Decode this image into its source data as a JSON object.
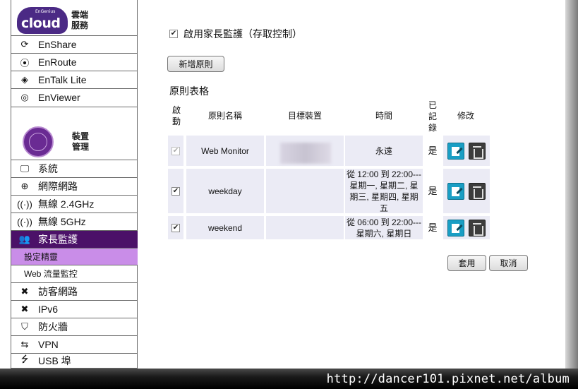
{
  "sidebar": {
    "logo": {
      "brand": "cloud",
      "maker": "EnGenius",
      "caption_line1": "雲端",
      "caption_line2": "服務"
    },
    "cloud_items": [
      {
        "label": "EnShare",
        "icon": "sync-icon"
      },
      {
        "label": "EnRoute",
        "icon": "location-pin-icon"
      },
      {
        "label": "EnTalk Lite",
        "icon": "compass-icon"
      },
      {
        "label": "EnViewer",
        "icon": "camera-lens-icon"
      }
    ],
    "device": {
      "caption_line1": "裝置",
      "caption_line2": "管理"
    },
    "device_items": [
      {
        "label": "系統",
        "icon": "monitor-icon"
      },
      {
        "label": "網際網路",
        "icon": "globe-icon"
      },
      {
        "label": "無線 2.4GHz",
        "icon": "wireless-icon"
      },
      {
        "label": "無線 5GHz",
        "icon": "wireless-icon"
      },
      {
        "label": "家長監護",
        "icon": "users-icon"
      }
    ],
    "sub_items": [
      {
        "label": "設定精靈"
      },
      {
        "label": "Web 流量監控"
      }
    ],
    "more_items": [
      {
        "label": "訪客網路",
        "icon": "tools-icon"
      },
      {
        "label": "IPv6",
        "icon": "tools-icon"
      },
      {
        "label": "防火牆",
        "icon": "shield-icon"
      },
      {
        "label": "VPN",
        "icon": "arrows-icon"
      },
      {
        "label": "USB 埠",
        "icon": "usb-icon"
      }
    ]
  },
  "main": {
    "enable_label": "啟用家長監護（存取控制）",
    "add_rule_button": "新增原則",
    "table_title": "原則表格",
    "headers": {
      "enabled_1": "啟",
      "enabled_2": "動",
      "name": "原則名稱",
      "target": "目標裝置",
      "time": "時間",
      "logged_1": "已",
      "logged_2": "記",
      "logged_3": "錄",
      "edit": "修改"
    },
    "rules": [
      {
        "name": "Web Monitor",
        "time_line1": "永遠",
        "time_line2": "",
        "time_line3": "",
        "time_line4": "",
        "logged": "是"
      },
      {
        "name": "weekday",
        "time_line1": "從 12:00 到 22:00---",
        "time_line2": "星期一, 星期二, 星",
        "time_line3": "期三, 星期四, 星期",
        "time_line4": "五",
        "logged": "是"
      },
      {
        "name": "weekend",
        "time_line1": "從 06:00 到 22:00---",
        "time_line2": "星期六, 星期日",
        "time_line3": "",
        "time_line4": "",
        "logged": "是"
      }
    ],
    "apply_button": "套用",
    "cancel_button": "取消"
  },
  "watermark": "http://dancer101.pixnet.net/album"
}
